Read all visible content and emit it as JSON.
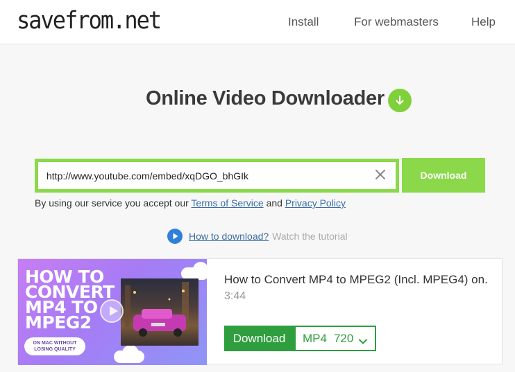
{
  "header": {
    "logo": "savefrom.net",
    "nav": [
      "Install",
      "For webmasters",
      "Help"
    ]
  },
  "hero": {
    "title": "Online Video Downloader",
    "badge_icon": "download-arrow-icon",
    "accent": "#7fd03a"
  },
  "search": {
    "value": "http://www.youtube.com/embed/xqDGO_bhGIk",
    "clear_icon": "close-icon",
    "download_label": "Download",
    "border_color": "#8bd94a"
  },
  "terms": {
    "prefix": "By using our service you accept our",
    "tos_link": "Terms of Service",
    "and": "and",
    "privacy_link": "Privacy Policy"
  },
  "howto": {
    "icon": "play-circle-icon",
    "link": "How to download?",
    "hint": "Watch the tutorial"
  },
  "result": {
    "thumbnail": {
      "headline": "HOW TO\nCONVERT\nMP4 TO\nMPEG2",
      "pill": "ON MAC WITHOUT LOSING QUALITY"
    },
    "title": "How to Convert MP4 to MPEG2 (Incl. MPEG4) on...",
    "duration": "3:44",
    "download_label": "Download",
    "format": "MP4",
    "quality": "720",
    "button_color": "#2e9e3e"
  }
}
